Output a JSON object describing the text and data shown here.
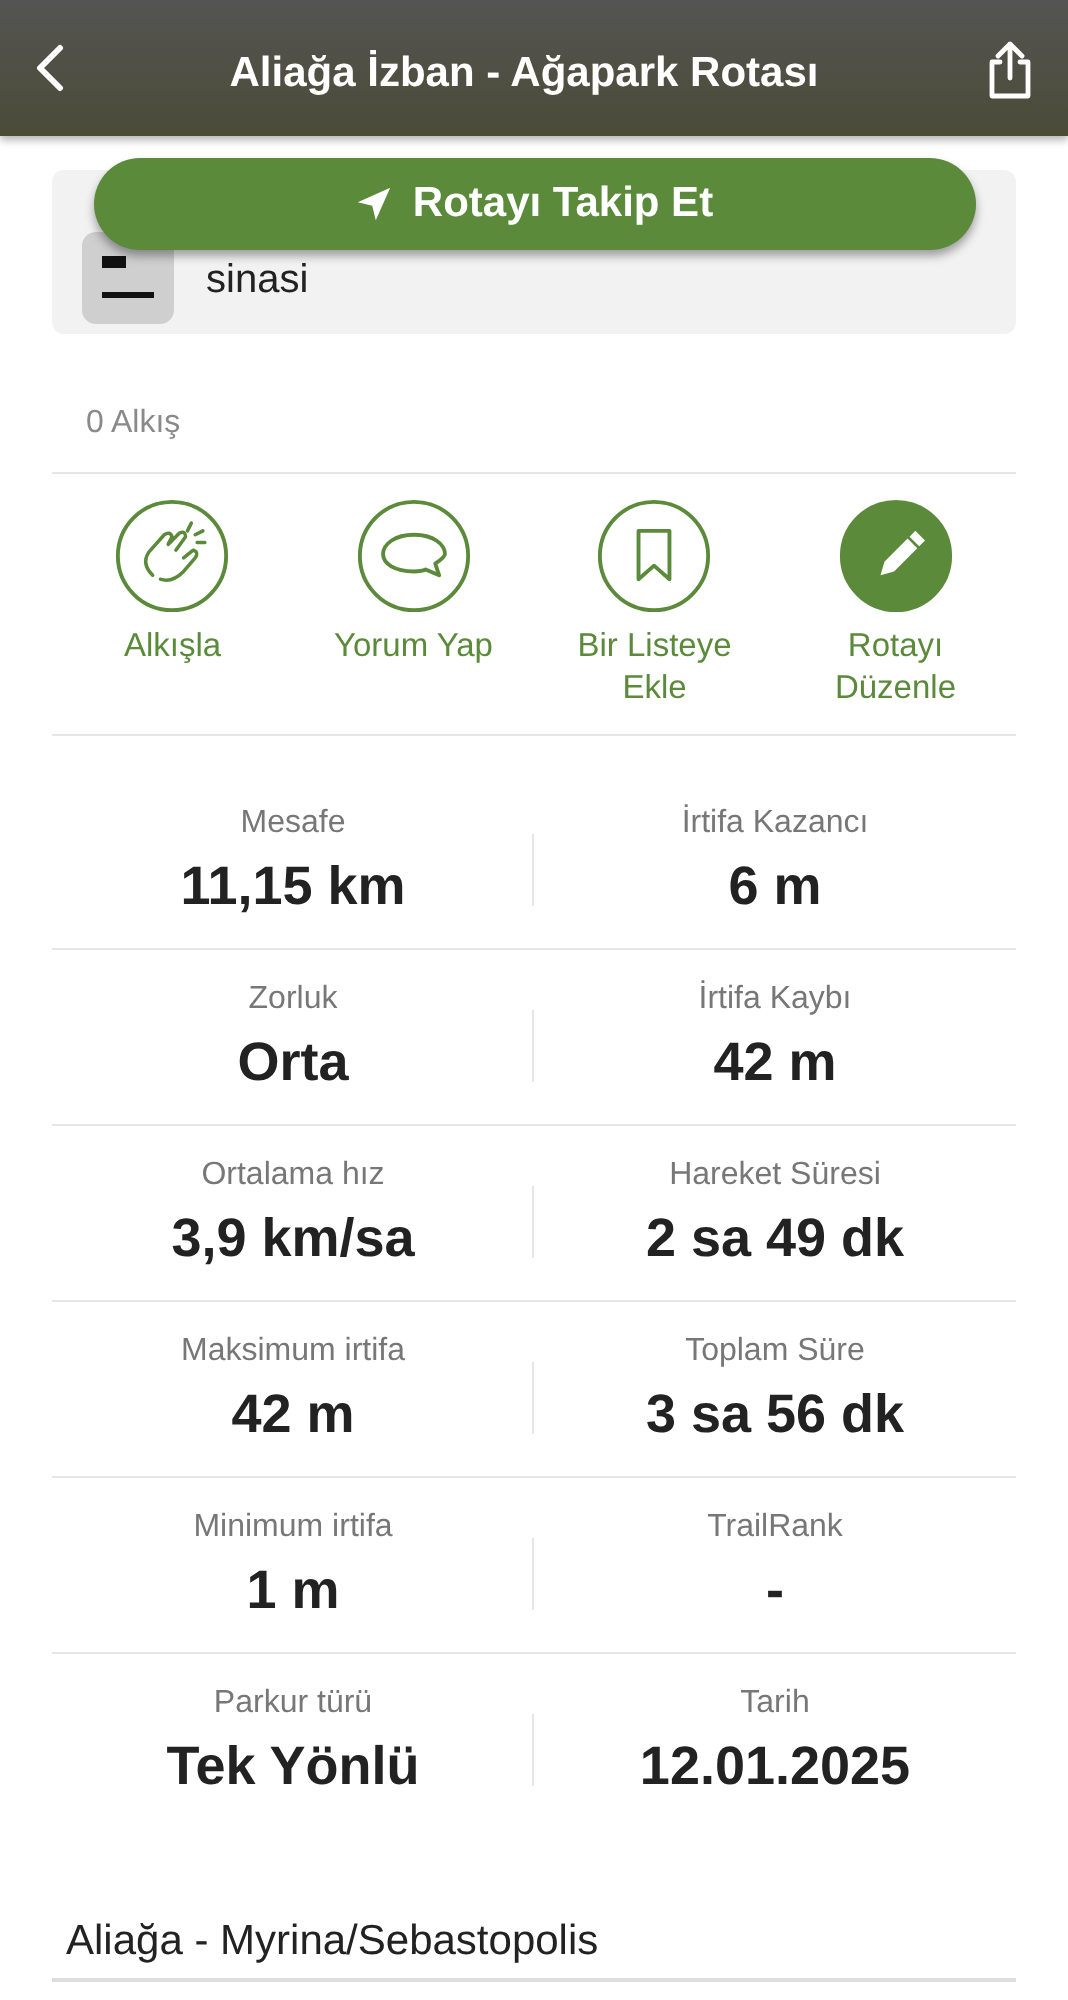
{
  "header": {
    "title": "Aliağa İzban - Ağapark Rotası"
  },
  "follow_button": {
    "label": "Rotayı Takip Et"
  },
  "author": {
    "name": "sinasi"
  },
  "claps": {
    "count": "0 Alkış"
  },
  "actions": [
    {
      "label": "Alkışla",
      "kind": "outline"
    },
    {
      "label": "Yorum Yap",
      "kind": "outline"
    },
    {
      "label": "Bir Listeye Ekle",
      "kind": "outline"
    },
    {
      "label": "Rotayı Düzenle",
      "kind": "filled"
    }
  ],
  "stats": [
    {
      "label": "Mesafe",
      "value": "11,15 km"
    },
    {
      "label": "İrtifa Kazancı",
      "value": "6 m"
    },
    {
      "label": "Zorluk",
      "value": "Orta"
    },
    {
      "label": "İrtifa Kaybı",
      "value": "42 m"
    },
    {
      "label": "Ortalama hız",
      "value": "3,9 km/sa"
    },
    {
      "label": "Hareket Süresi",
      "value": "2 sa 49 dk"
    },
    {
      "label": "Maksimum irtifa",
      "value": "42 m"
    },
    {
      "label": "Toplam Süre",
      "value": "3 sa 56 dk"
    },
    {
      "label": "Minimum irtifa",
      "value": "1 m"
    },
    {
      "label": "TrailRank",
      "value": "-"
    },
    {
      "label": "Parkur türü",
      "value": "Tek Yönlü"
    },
    {
      "label": "Tarih",
      "value": "12.01.2025"
    }
  ],
  "description": "Aliağa - Myrina/Sebastopolis"
}
